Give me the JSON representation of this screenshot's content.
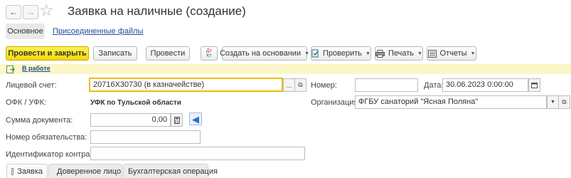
{
  "window": {
    "title": "Заявка на наличные (создание)"
  },
  "nav": {
    "back_icon": "arrow-left-icon",
    "forward_icon": "arrow-right-icon",
    "favorite_icon": "star-icon"
  },
  "tabs": {
    "main": "Основное",
    "attachments": "Присоединенные файлы"
  },
  "toolbar": {
    "post_and_close": "Провести и закрыть",
    "save": "Записать",
    "post": "Провести",
    "create_based_on": "Создать на основании",
    "check": "Проверить",
    "print": "Печать",
    "reports": "Отчеты"
  },
  "status": {
    "text": "В работе"
  },
  "form": {
    "account_label": "Лицевой счет:",
    "account_value": "20716Х30730 (в казначействе)",
    "number_label": "Номер:",
    "number_value": "",
    "date_label": "Дата:",
    "date_value": "30.06.2023  0:00:00",
    "ofk_label": "ОФК / УФК:",
    "ofk_value": "УФК по Тульской области",
    "org_label": "Организация:",
    "org_value": "ФГБУ санаторий \"Ясная Поляна\"",
    "sum_label": "Сумма документа:",
    "sum_value": "0,00",
    "obligation_label": "Номер обязательства:",
    "obligation_value": "",
    "contract_label": "Идентификатор контракта:",
    "contract_value": ""
  },
  "bottom_tabs": {
    "request": "Заявка",
    "trusted": "Доверенное лицо",
    "accounting": "Бухгалтерская операция"
  }
}
